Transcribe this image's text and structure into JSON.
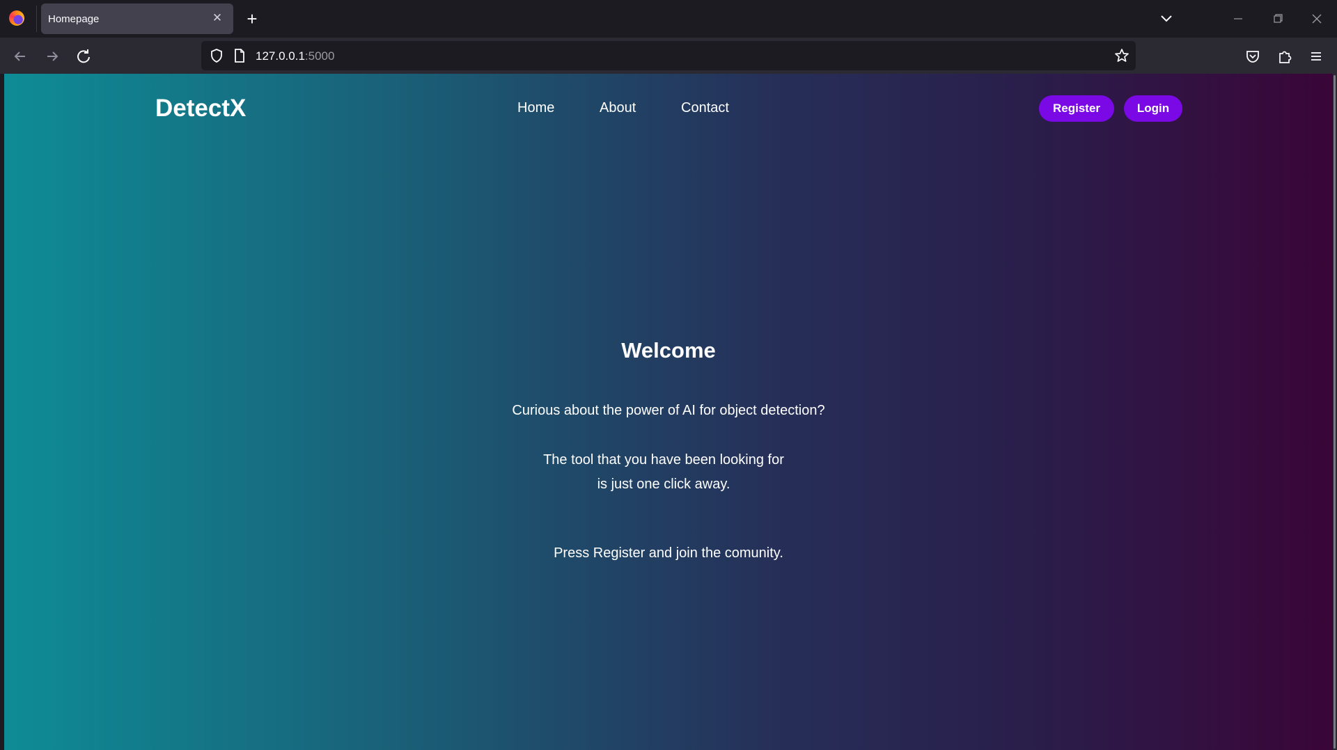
{
  "browser": {
    "tab_title": "Homepage",
    "url_host": "127.0.0.1",
    "url_port": ":5000"
  },
  "site": {
    "brand": "DetectX",
    "nav": [
      "Home",
      "About",
      "Contact"
    ],
    "register_label": "Register",
    "login_label": "Login",
    "accent_color": "#7b09e6"
  },
  "hero": {
    "title": "Welcome",
    "line1": "Curious about the power of AI for object detection?",
    "line2": "The tool that you have been looking for",
    "line3": "is just one click away.",
    "line4": "Press Register and join the comunity."
  }
}
